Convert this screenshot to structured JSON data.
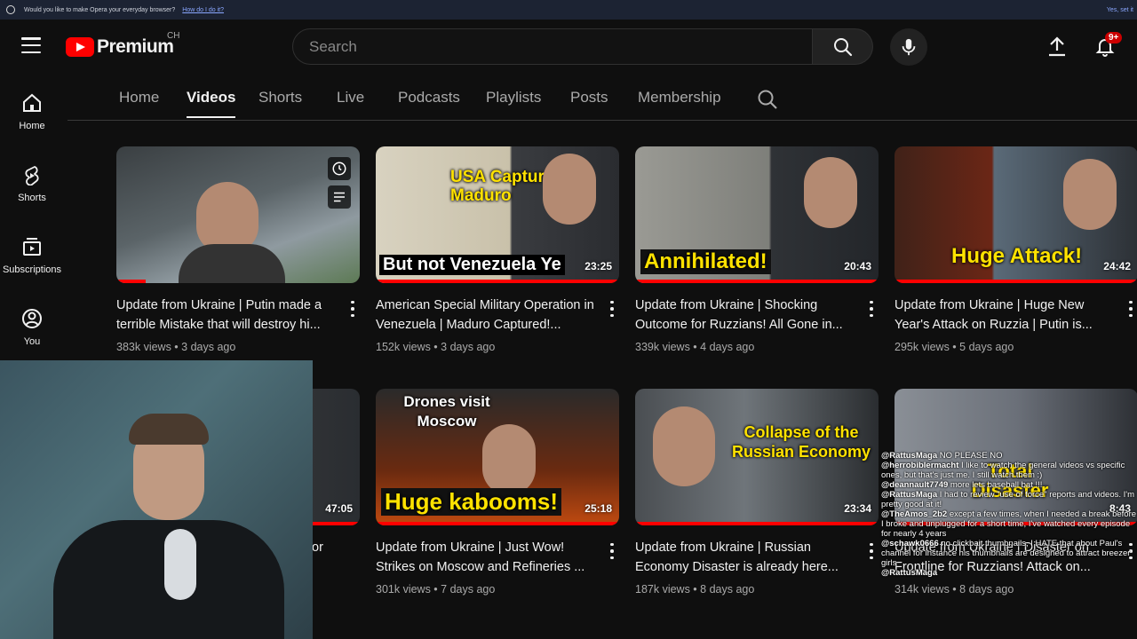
{
  "opera_bar": {
    "prompt": "Would you like to make Opera your everyday browser?",
    "link": "How do I do it?",
    "accept": "Yes, set it"
  },
  "header": {
    "brand": "Premium",
    "country": "CH",
    "search_placeholder": "Search",
    "notifications_badge": "9+"
  },
  "sidebar": {
    "items": [
      {
        "label": "Home",
        "icon": "home-icon"
      },
      {
        "label": "Shorts",
        "icon": "shorts-icon"
      },
      {
        "label": "Subscriptions",
        "icon": "subscriptions-icon"
      },
      {
        "label": "You",
        "icon": "you-icon"
      }
    ]
  },
  "tabs": [
    {
      "label": "Home"
    },
    {
      "label": "Videos",
      "active": true
    },
    {
      "label": "Shorts"
    },
    {
      "label": "Live"
    },
    {
      "label": "Podcasts"
    },
    {
      "label": "Playlists"
    },
    {
      "label": "Posts"
    },
    {
      "label": "Membership"
    }
  ],
  "videos": [
    {
      "title": "Update from Ukraine | Putin made a terrible Mistake that will destroy hi...",
      "meta": "383k views • 3 days ago",
      "duration": "",
      "caption": "",
      "watched_fraction": 0.12
    },
    {
      "title": "American Special Military Operation in Venezuela | Maduro Captured!...",
      "meta": "152k views • 3 days ago",
      "duration": "23:25",
      "caption": "USA Captured Maduro",
      "caption2": "But not Venezuela Ye",
      "watched_fraction": 1.0
    },
    {
      "title": "Update from Ukraine | Shocking Outcome for Ruzzians! All Gone in...",
      "meta": "339k views • 4 days ago",
      "duration": "20:43",
      "caption": "Annihilated!",
      "watched_fraction": 1.0
    },
    {
      "title": "Update from Ukraine | Huge New Year's Attack on Ruzzia | Putin is...",
      "meta": "295k views • 5 days ago",
      "duration": "24:42",
      "caption": "Huge Attack!",
      "watched_fraction": 1.0
    },
    {
      "title": "Update from Ukraine | Just Wow! Strikes on Moscow and Refineries ...",
      "meta": "301k views • 7 days ago",
      "duration": "25:18",
      "caption": "Drones visit Moscow",
      "caption2": "Huge kabooms!",
      "watched_fraction": 1.0
    },
    {
      "title": "Update from Ukraine | Russian Economy Disaster is already here...",
      "meta": "187k views • 8 days ago",
      "duration": "23:34",
      "caption": "Collapse of the Russian Economy",
      "watched_fraction": 1.0
    },
    {
      "title": "Update from Ukraine | Disaster on Frontline for Ruzzians! Attack on...",
      "meta": "314k views • 8 days ago",
      "duration": "8:43",
      "caption": "Total Disaster",
      "watched_fraction": 1.0
    }
  ],
  "hidden_card": {
    "duration": "47:05",
    "title_fragment": "or"
  },
  "chat": [
    {
      "user": "@RattusMaga",
      "text": "NO PLEASE NO"
    },
    {
      "user": "@herrobiblermacht",
      "text": "I like to watch the general videos vs specific ones, but that's just me. I still watch them :)"
    },
    {
      "user": "@deannault7749",
      "text": "more lets baseball bat !!!"
    },
    {
      "user": "@RattusMaga",
      "text": "I had to review \"use of force\" reports and videos. I'm pretty good at it!"
    },
    {
      "user": "@TheAmos_2b2",
      "text": "except a few times, when I needed a break before I broke and unplugged for a short time, I've watched every episode for nearly 4 years"
    },
    {
      "user": "@schawk0666",
      "text": "no clickbait thumbnails, I HATE that about Paul's channel for instance his thumbnails are designed to attract breezer girls"
    },
    {
      "user": "@RattusMaga",
      "text": ""
    }
  ]
}
